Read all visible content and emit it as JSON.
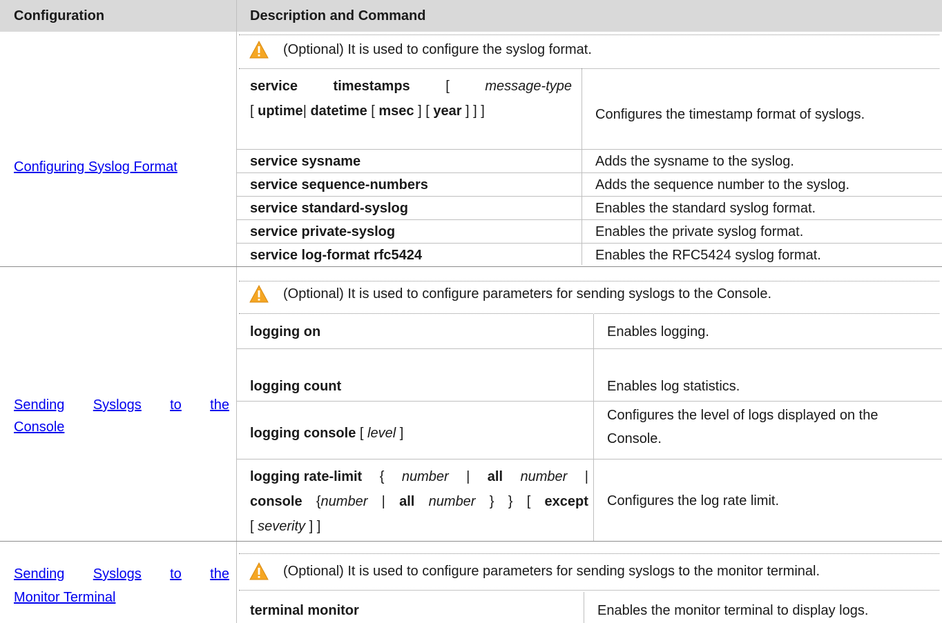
{
  "header": {
    "configuration": "Configuration",
    "description": "Description and Command"
  },
  "sections": [
    {
      "link": "Configuring Syslog Format",
      "note": "(Optional) It is used to configure the syslog format.",
      "rows": [
        {
          "command": "service timestamps [ message-type [ uptime| datetime [ msec ] [ year ] ] ]",
          "description": "Configures the timestamp format of syslogs."
        },
        {
          "command": "service sysname",
          "description": "Adds the sysname to the syslog."
        },
        {
          "command": "service sequence-numbers",
          "description": "Adds the sequence number to the syslog."
        },
        {
          "command": "service standard-syslog",
          "description": "Enables the standard syslog format."
        },
        {
          "command": "service private-syslog",
          "description": "Enables the private syslog format."
        },
        {
          "command": "service log-format rfc5424",
          "description": "Enables the RFC5424 syslog format."
        }
      ]
    },
    {
      "link": "Sending Syslogs to the Console",
      "note": "(Optional) It is used to configure parameters for sending syslogs to the Console.",
      "rows": [
        {
          "command": "logging on",
          "description": "Enables logging."
        },
        {
          "command": "logging count",
          "description": "Enables log statistics."
        },
        {
          "command": "logging console [ level ]",
          "description": "Configures the level of logs displayed on the Console."
        },
        {
          "command": "logging rate-limit { number | all number | console {number | all number } } [ except [ severity ] ]",
          "description": "Configures the log rate limit."
        }
      ]
    },
    {
      "link": "Sending Syslogs to the Monitor Terminal",
      "note": "(Optional) It is used to configure parameters for sending syslogs to the monitor terminal.",
      "rows": [
        {
          "command": "terminal monitor",
          "description": "Enables the monitor terminal to display logs."
        }
      ]
    }
  ],
  "colors": {
    "header_bg": "#d9d9d9",
    "link": "#0000ee",
    "warning": "#f5a623"
  },
  "icons": {
    "warning": "warning-triangle-icon"
  }
}
